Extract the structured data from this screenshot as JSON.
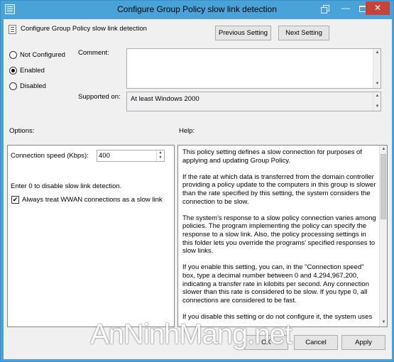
{
  "window": {
    "title": "Configure Group Policy slow link detection",
    "minimize_glyph": "—",
    "close_glyph": "✕"
  },
  "header": {
    "policy_name": "Configure Group Policy slow link detection",
    "prev_label": "Previous Setting",
    "next_label": "Next Setting"
  },
  "state": {
    "options": [
      "Not Configured",
      "Enabled",
      "Disabled"
    ],
    "selected": "Enabled"
  },
  "comment": {
    "label": "Comment:",
    "value": ""
  },
  "supported": {
    "label": "Supported on:",
    "value": "At least Windows 2000"
  },
  "options_panel": {
    "heading": "Options:",
    "speed_label": "Connection speed (Kbps):",
    "speed_value": "400",
    "hint": "Enter 0 to disable slow link detection.",
    "wwan_label": "Always treat WWAN connections as a slow link",
    "wwan_checked": true,
    "check_glyph": "✔"
  },
  "help_panel": {
    "heading": "Help:",
    "paragraphs": [
      "This policy setting defines a slow connection for purposes of applying and updating Group Policy.",
      "If the rate at which data is transferred from the domain controller providing a policy update to the computers in this group is slower than the rate specified by this setting, the system considers the connection to be slow.",
      "The system's response to a slow policy connection varies among policies. The program implementing the policy can specify the response to a slow link. Also, the policy processing settings in this folder lets you override the programs' specified responses to slow links.",
      "If you enable this setting, you can, in the \"Connection speed\" box, type a decimal number between 0 and 4,294,967,200, indicating a transfer rate in kilobits per second. Any connection slower than this rate is considered to be slow. If you type 0, all connections are considered to be fast.",
      "If you disable this setting or do not configure it, the system uses"
    ]
  },
  "footer": {
    "ok_label": "OK",
    "cancel_label": "Cancel",
    "apply_label": "Apply"
  },
  "watermark": "AnNinhMang.net"
}
